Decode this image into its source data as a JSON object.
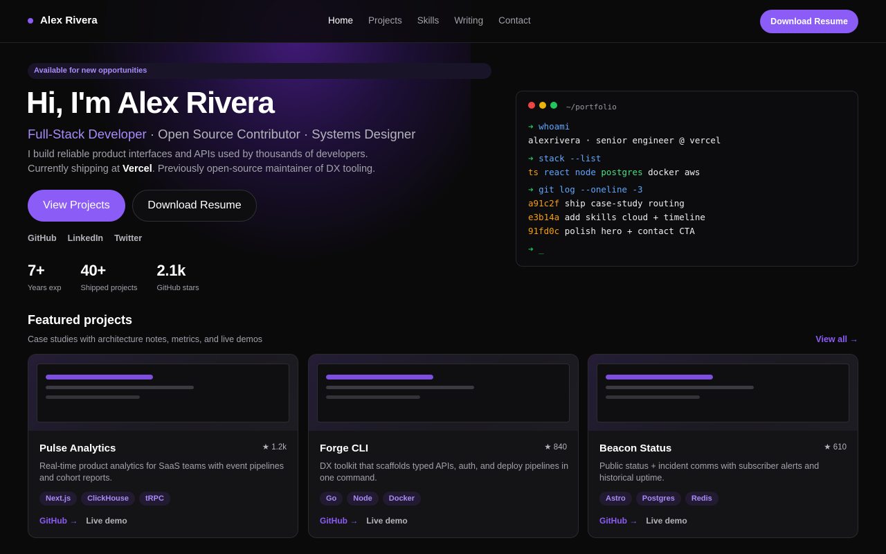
{
  "nav": {
    "brand": "Alex Rivera",
    "links": [
      "Home",
      "Projects",
      "Skills",
      "Writing",
      "Contact"
    ],
    "active": "Home",
    "cta": "Download Resume"
  },
  "hero": {
    "badge": "Available for new opportunities",
    "title": "Hi, I'm Alex Rivera",
    "role": "Full-Stack Developer",
    "role_rest": " · Open Source Contributor · Systems Designer",
    "desc_line1": "I build reliable product interfaces and APIs used by thousands of developers.",
    "desc_line2_pre": "Currently shipping at ",
    "desc_company": "Vercel",
    "desc_line2_post": ". Previously open-source maintainer of DX tooling.",
    "primary_button": "View Projects",
    "secondary_button": "Download Resume",
    "socials": [
      "GitHub",
      "LinkedIn",
      "Twitter"
    ],
    "stats": [
      {
        "value": "7+",
        "label": "Years exp"
      },
      {
        "value": "40+",
        "label": "Shipped projects"
      },
      {
        "value": "2.1k",
        "label": "GitHub stars"
      }
    ]
  },
  "terminal": {
    "path": "~/portfolio",
    "prompt": "➜",
    "cmd1": "whoami",
    "out1": "alexrivera · senior engineer @ vercel",
    "cmd2": "stack --list",
    "stack": [
      "ts",
      "react",
      "node",
      "postgres",
      "docker",
      "aws"
    ],
    "cmd3": "git log --oneline -3",
    "commits": [
      {
        "hash": "a91c2f",
        "msg": "ship case-study routing"
      },
      {
        "hash": "e3b14a",
        "msg": "add skills cloud + timeline"
      },
      {
        "hash": "91fd0c",
        "msg": "polish hero + contact CTA"
      }
    ],
    "cursor": "_",
    "dot_colors": [
      "#ef4444",
      "#eab308",
      "#22c55e"
    ]
  },
  "featured": {
    "title": "Featured projects",
    "subtitle": "Case studies with architecture notes, metrics, and live demos",
    "view_all": "View all →",
    "projects": [
      {
        "name": "Pulse Analytics",
        "stars": "★ 1.2k",
        "desc": "Real-time product analytics for SaaS teams with event pipelines and cohort reports.",
        "tags": [
          "Next.js",
          "ClickHouse",
          "tRPC"
        ],
        "github": "GitHub →",
        "demo": "Live demo"
      },
      {
        "name": "Forge CLI",
        "stars": "★ 840",
        "desc": "DX toolkit that scaffolds typed APIs, auth, and deploy pipelines in one command.",
        "tags": [
          "Go",
          "Node",
          "Docker"
        ],
        "github": "GitHub →",
        "demo": "Live demo"
      },
      {
        "name": "Beacon Status",
        "stars": "★ 610",
        "desc": "Public status + incident comms with subscriber alerts and historical uptime.",
        "tags": [
          "Astro",
          "Postgres",
          "Redis"
        ],
        "github": "GitHub →",
        "demo": "Live demo"
      }
    ]
  },
  "colors": {
    "accent": "#8b5cf6",
    "accent_light": "#a78bfa",
    "background": "#0a0a0b",
    "card": "#141416"
  }
}
